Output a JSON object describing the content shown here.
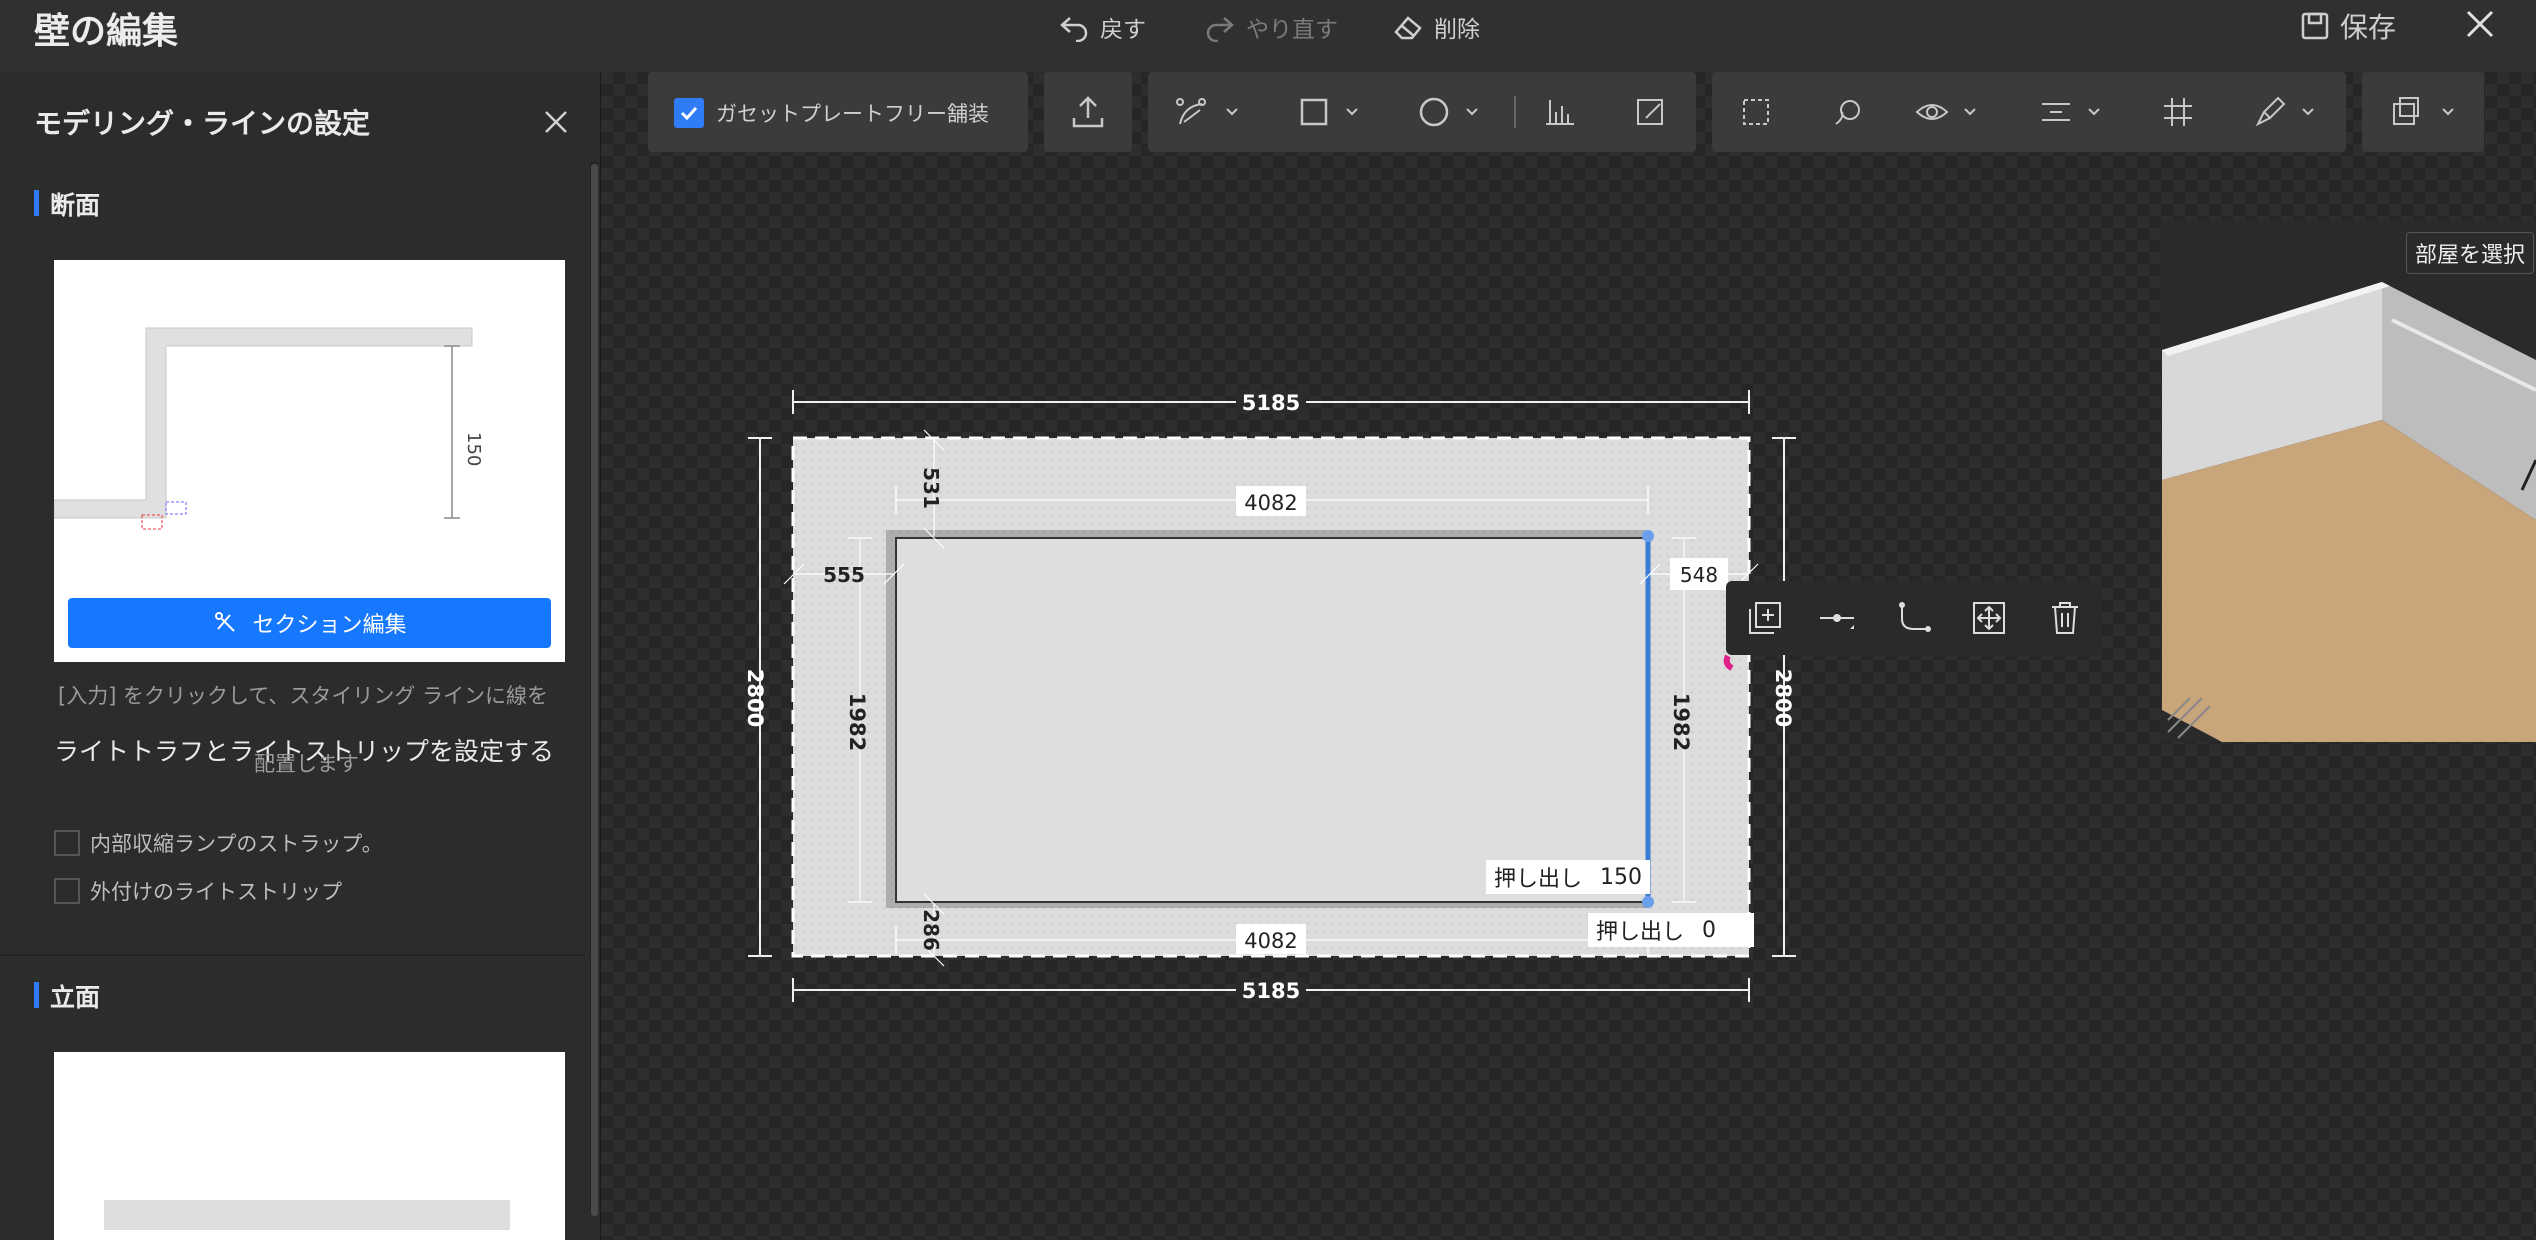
{
  "header": {
    "title": "壁の編集",
    "undo_label": "戻す",
    "redo_label": "やり直す",
    "delete_label": "削除",
    "save_label": "保存"
  },
  "left_panel": {
    "title": "モデリング・ラインの設定",
    "section_title": "断面",
    "section_preview_dim": "150",
    "section_edit_label": "セクション編集",
    "hint_line1": "[入力] をクリックして、スタイリング ラインに線を",
    "hint_line2": "配置します",
    "light_title": "ライトトラフとライトストリップを設定する",
    "check_inner_label": "内部収縮ランプのストラップ。",
    "check_outer_label": "外付けのライトストリップ",
    "elevation_title": "立面"
  },
  "toolbar": {
    "gasset_label": "ガセットプレートフリー舗装",
    "gasset_checked": true
  },
  "drawing": {
    "outer_width": "5185",
    "outer_height": "2800",
    "inner_width": "4082",
    "inner_height": "1982",
    "offset_top": "531",
    "offset_bottom": "286",
    "offset_left": "555",
    "offset_right": "548"
  },
  "extrude": {
    "label": "押し出し",
    "value_inner": "150",
    "value_outer": "0"
  },
  "preview": {
    "room_select_label": "部屋を選択"
  },
  "colors": {
    "accent": "#2f7cf6",
    "button_blue": "#1677ff",
    "wall_gray": "#dcdcdc",
    "selection_blue": "#3a7bd5"
  }
}
